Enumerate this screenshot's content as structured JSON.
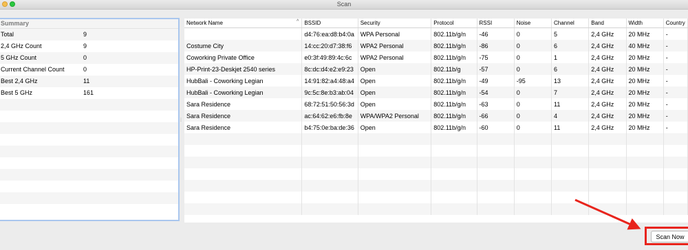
{
  "window": {
    "title": "Scan"
  },
  "summary": {
    "header": "Summary",
    "rows": [
      {
        "label": "Total",
        "value": "9"
      },
      {
        "label": "2,4 GHz Count",
        "value": "9"
      },
      {
        "label": "5 GHz Count",
        "value": "0"
      },
      {
        "label": "Current Channel Count",
        "value": "0"
      },
      {
        "label": "Best 2,4 GHz",
        "value": "11"
      },
      {
        "label": "Best 5 GHz",
        "value": "161"
      }
    ]
  },
  "networks": {
    "columns": [
      "Network Name",
      "BSSID",
      "Security",
      "Protocol",
      "RSSI",
      "Noise",
      "Channel",
      "Band",
      "Width",
      "Country"
    ],
    "sort_column": "Network Name",
    "sort_direction": "ascending",
    "rows": [
      [
        "",
        "d4:76:ea:d8:b4:0a",
        "WPA Personal",
        "802.11b/g/n",
        "-46",
        "0",
        "5",
        "2,4 GHz",
        "20 MHz",
        "-"
      ],
      [
        "Costume City",
        "14:cc:20:d7:38:f6",
        "WPA2 Personal",
        "802.11b/g/n",
        "-86",
        "0",
        "6",
        "2,4 GHz",
        "40 MHz",
        "-"
      ],
      [
        "Coworking Private Office",
        "e0:3f:49:89:4c:6c",
        "WPA2 Personal",
        "802.11b/g/n",
        "-75",
        "0",
        "1",
        "2,4 GHz",
        "20 MHz",
        "-"
      ],
      [
        "HP-Print-23-Deskjet 2540 series",
        "8c:dc:d4:e2:e9:23",
        "Open",
        "802.11b/g",
        "-57",
        "0",
        "6",
        "2,4 GHz",
        "20 MHz",
        "-"
      ],
      [
        "HubBali - Coworking Legian",
        "14:91:82:a4:48:a4",
        "Open",
        "802.11b/g/n",
        "-49",
        "-95",
        "13",
        "2,4 GHz",
        "20 MHz",
        "-"
      ],
      [
        "HubBali - Coworking Legian",
        "9c:5c:8e:b3:ab:04",
        "Open",
        "802.11b/g/n",
        "-54",
        "0",
        "7",
        "2,4 GHz",
        "20 MHz",
        "-"
      ],
      [
        "Sara Residence",
        "68:72:51:50:56:3d",
        "Open",
        "802.11b/g/n",
        "-63",
        "0",
        "11",
        "2,4 GHz",
        "20 MHz",
        "-"
      ],
      [
        "Sara Residence",
        "ac:64:62:e6:fb:8e",
        "WPA/WPA2 Personal",
        "802.11b/g/n",
        "-66",
        "0",
        "4",
        "2,4 GHz",
        "20 MHz",
        "-"
      ],
      [
        "Sara Residence",
        "b4:75:0e:ba:de:36",
        "Open",
        "802.11b/g/n",
        "-60",
        "0",
        "11",
        "2,4 GHz",
        "20 MHz",
        "-"
      ]
    ]
  },
  "actions": {
    "scan_now": "Scan Now"
  },
  "annotation": {
    "color": "#e8241c",
    "target": "Scan Now"
  }
}
